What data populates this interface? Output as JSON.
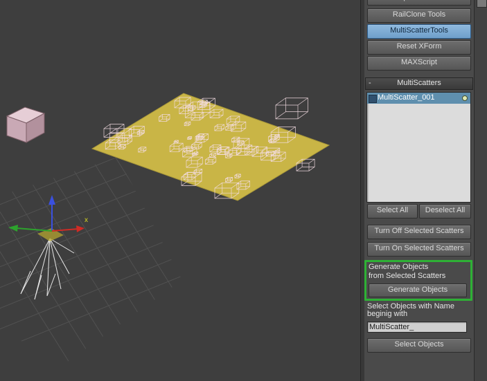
{
  "colors": {
    "viewport_bg": "#3e3e3e",
    "panel_bg": "#4a4a4a",
    "button_text": "#d9d9d9",
    "active_button_bg": "#6f9fca",
    "plane_yellow": "#c9b546",
    "wire_pink": "#f4dde3",
    "highlight_green": "#2eb135",
    "list_bg": "#dcdcdc",
    "selected_row_bg": "#5f8fae"
  },
  "panel": {
    "toolbar_buttons": [
      {
        "label": "Perspective Match"
      },
      {
        "label": "RailClone Tools"
      },
      {
        "label": "MultiScatterTools",
        "active": true
      },
      {
        "label": "Reset XForm"
      },
      {
        "label": "MAXScript"
      }
    ],
    "rollout": {
      "collapse_glyph": "-",
      "title": "MultiScatters"
    },
    "scatter_list": {
      "items": [
        {
          "name": "MultiScatter_001",
          "selected": true,
          "enabled": true
        }
      ]
    },
    "list_buttons": {
      "select_all": "Select All",
      "deselect_all": "Deselect All"
    },
    "turn_off_label": "Turn Off Selected Scatters",
    "turn_on_label": "Turn On Selected Scatters",
    "generate": {
      "caption_line1": "Generate Objects",
      "caption_line2": "from Selected Scatters",
      "button_label": "Generate Objects"
    },
    "select_by_name": {
      "caption_line1": "Select Objects with Name",
      "caption_line2": "beginig with",
      "input_value": "MultiScatter_",
      "button_label": "Select Objects"
    }
  },
  "viewport": {
    "axis_label_x": "x"
  }
}
